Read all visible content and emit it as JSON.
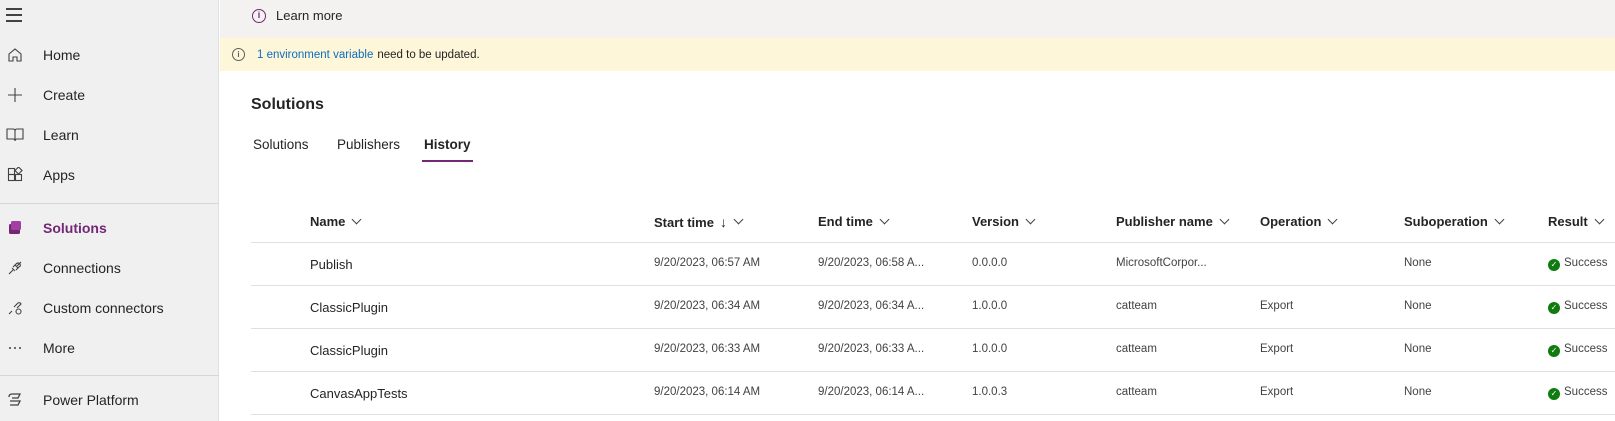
{
  "sidebar": {
    "menu_icon": "hamburger-icon",
    "items": [
      {
        "label": "Home",
        "icon": "home-icon"
      },
      {
        "label": "Create",
        "icon": "plus-icon"
      },
      {
        "label": "Learn",
        "icon": "book-icon"
      },
      {
        "label": "Apps",
        "icon": "apps-icon"
      },
      {
        "label": "Solutions",
        "icon": "solutions-icon",
        "active": true
      },
      {
        "label": "Connections",
        "icon": "connections-icon"
      },
      {
        "label": "Custom connectors",
        "icon": "custom-connectors-icon"
      },
      {
        "label": "More",
        "icon": "more-icon"
      },
      {
        "label": "Power Platform",
        "icon": "power-platform-icon"
      }
    ]
  },
  "topbar": {
    "learn_more": "Learn more"
  },
  "banner": {
    "link_text": "1 environment variable",
    "rest_text": "need to be updated."
  },
  "page": {
    "title": "Solutions",
    "tabs": [
      {
        "label": "Solutions"
      },
      {
        "label": "Publishers"
      },
      {
        "label": "History",
        "selected": true
      }
    ]
  },
  "table": {
    "columns": [
      "Name",
      "Start time",
      "End time",
      "Version",
      "Publisher name",
      "Operation",
      "Suboperation",
      "Result"
    ],
    "sort_indicator": "↓",
    "rows": [
      {
        "name": "Publish",
        "start": "9/20/2023, 06:57 AM",
        "end": "9/20/2023, 06:58 A...",
        "version": "0.0.0.0",
        "publisher": "MicrosoftCorpor...",
        "operation": "",
        "suboperation": "None",
        "result": "Success"
      },
      {
        "name": "ClassicPlugin",
        "start": "9/20/2023, 06:34 AM",
        "end": "9/20/2023, 06:34 A...",
        "version": "1.0.0.0",
        "publisher": "catteam",
        "operation": "Export",
        "suboperation": "None",
        "result": "Success"
      },
      {
        "name": "ClassicPlugin",
        "start": "9/20/2023, 06:33 AM",
        "end": "9/20/2023, 06:33 A...",
        "version": "1.0.0.0",
        "publisher": "catteam",
        "operation": "Export",
        "suboperation": "None",
        "result": "Success"
      },
      {
        "name": "CanvasAppTests",
        "start": "9/20/2023, 06:14 AM",
        "end": "9/20/2023, 06:14 A...",
        "version": "1.0.0.3",
        "publisher": "catteam",
        "operation": "Export",
        "suboperation": "None",
        "result": "Success"
      }
    ]
  },
  "colors": {
    "accent": "#742774",
    "link": "#0f6cbd",
    "success": "#107c10",
    "banner_bg": "#fdf6d9"
  }
}
